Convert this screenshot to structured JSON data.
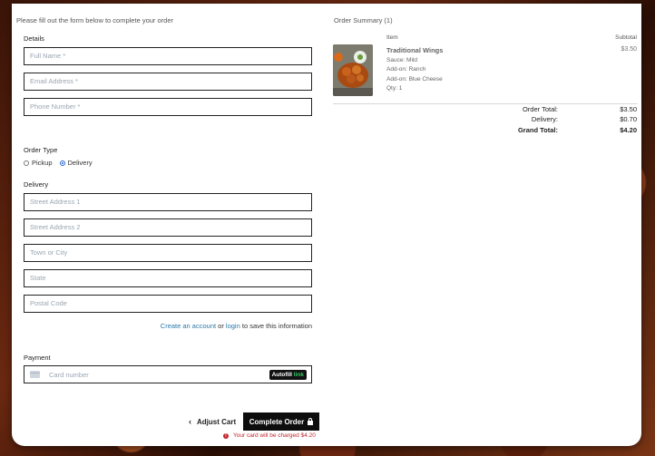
{
  "intro": "Please fill out the form below to complete your order",
  "details": {
    "label": "Details",
    "full_name_placeholder": "Full Name *",
    "email_placeholder": "Email Address *",
    "phone_placeholder": "Phone Number *"
  },
  "order_type": {
    "label": "Order Type",
    "options": [
      "Pickup",
      "Delivery"
    ],
    "selected": "Delivery"
  },
  "delivery": {
    "label": "Delivery",
    "street1_placeholder": "Street Address 1",
    "street2_placeholder": "Street Address 2",
    "city_placeholder": "Town or City",
    "state_placeholder": "State",
    "postal_placeholder": "Postal Code"
  },
  "save_info": {
    "create_account": "Create an account",
    "or": " or ",
    "login": "login",
    "suffix": " to save this information"
  },
  "payment": {
    "label": "Payment",
    "card_placeholder": "Card number",
    "autofill": "Autofill",
    "link": "link"
  },
  "actions": {
    "adjust_cart": "Adjust Cart",
    "complete_order": "Complete Order",
    "charge_note": "Your card will be charged $4.20"
  },
  "summary": {
    "title": "Order Summary (1)",
    "col_item": "Item",
    "col_subtotal": "Subtotal",
    "item": {
      "name": "Traditional Wings",
      "details": [
        "Sauce: Mild",
        "Add-on: Ranch",
        "Add-on: Blue Cheese",
        "Qty: 1"
      ],
      "subtotal": "$3.50"
    },
    "totals": [
      {
        "label": "Order Total:",
        "value": "$3.50"
      },
      {
        "label": "Delivery:",
        "value": "$0.70"
      },
      {
        "label": "Grand Total:",
        "value": "$4.20"
      }
    ]
  },
  "colors": {
    "accent_link": "#2a7aa8",
    "button_bg": "#0d0d0d",
    "error": "#c0262c",
    "link_green": "#33cc66"
  }
}
